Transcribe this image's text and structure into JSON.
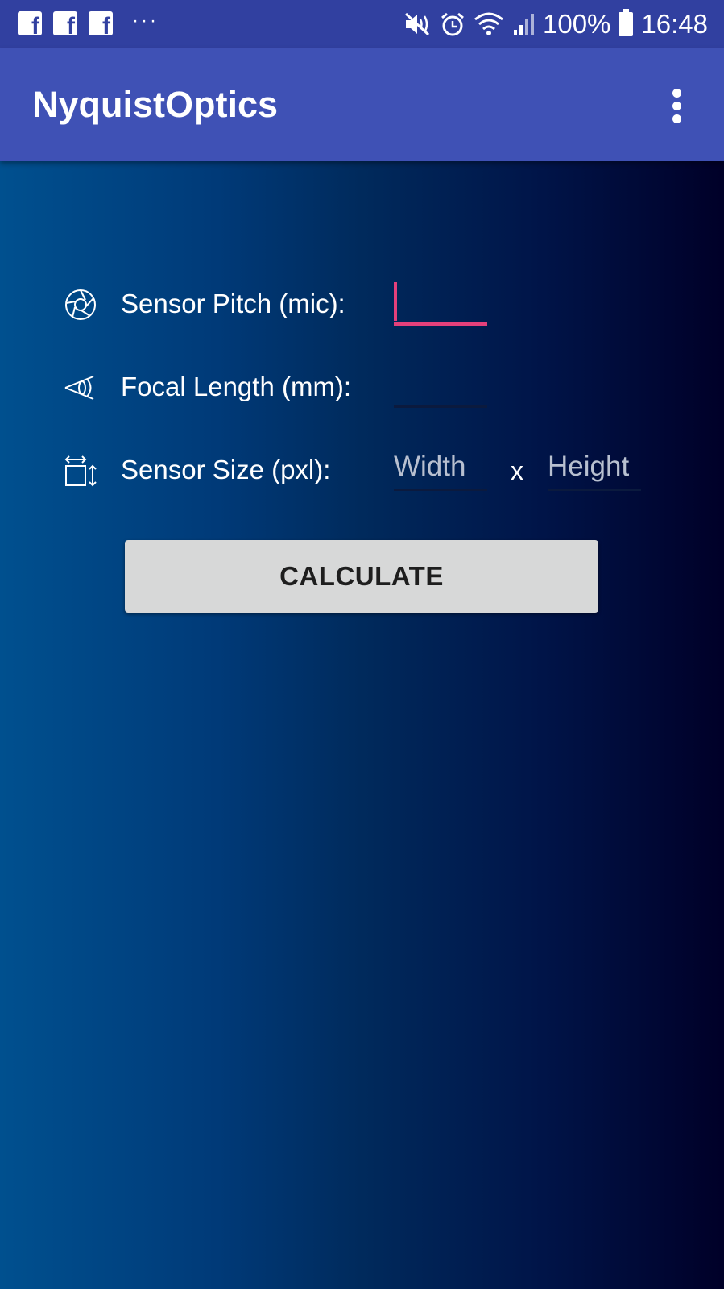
{
  "status_bar": {
    "notification_icons": [
      "facebook-icon",
      "facebook-icon",
      "facebook-icon"
    ],
    "more_notifications": "···",
    "battery_level": "100%",
    "time": "16:48",
    "system_icons": [
      "mute-icon",
      "alarm-icon",
      "wifi-icon",
      "signal-icon",
      "battery-icon"
    ]
  },
  "app_bar": {
    "title": "NyquistOptics",
    "menu_icon": "overflow-menu-icon"
  },
  "form": {
    "sensor_pitch": {
      "label": "Sensor Pitch (mic):",
      "value": "",
      "icon": "aperture-icon"
    },
    "focal_length": {
      "label": "Focal Length (mm):",
      "value": "",
      "icon": "eye-icon"
    },
    "sensor_size": {
      "label": "Sensor Size (pxl):",
      "icon": "resize-icon",
      "width_placeholder": "Width",
      "separator": "x",
      "height_placeholder": "Height"
    },
    "calculate_label": "CALCULATE"
  },
  "colors": {
    "status_bar": "#3140a0",
    "app_bar": "#3f51b5",
    "accent": "#e4407b",
    "button": "#d7d8d8"
  }
}
